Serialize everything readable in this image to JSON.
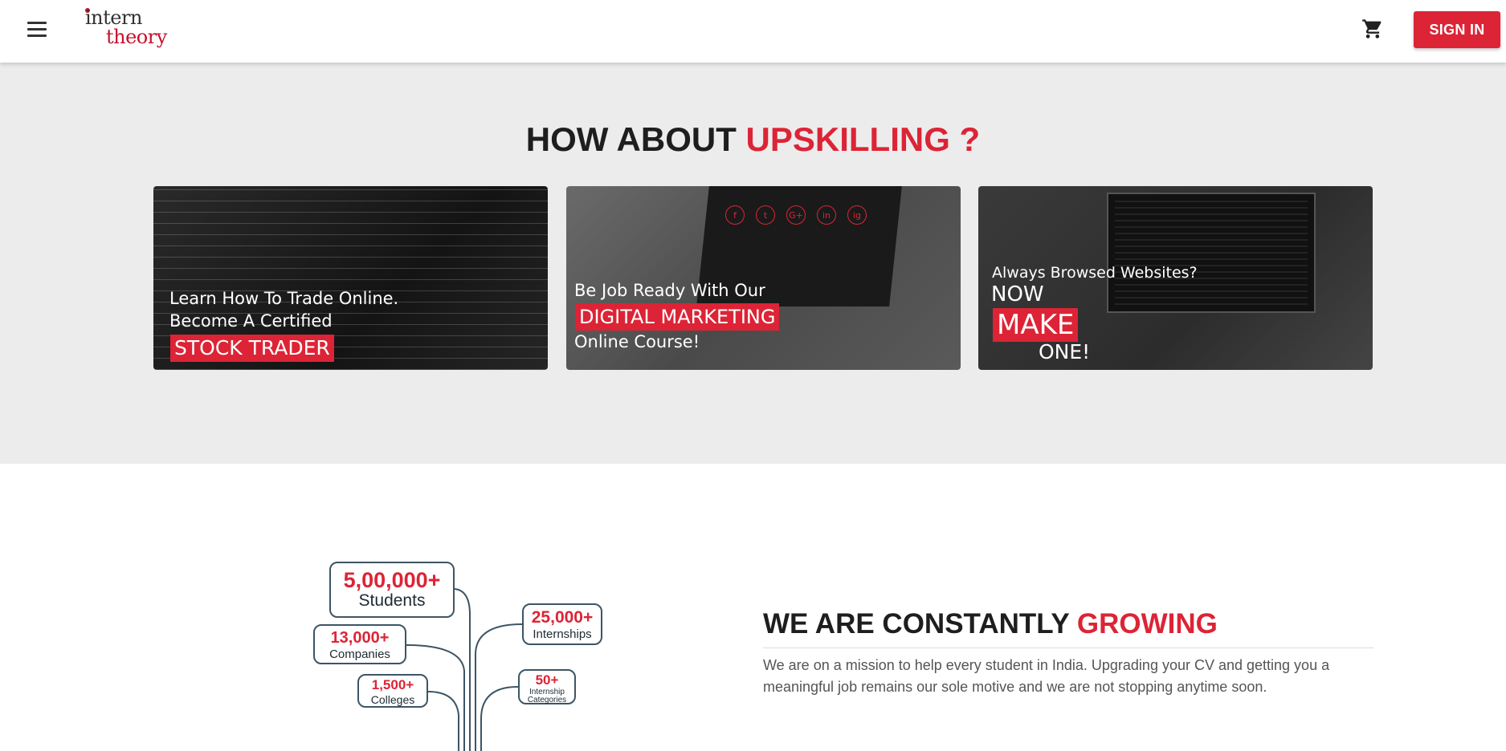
{
  "header": {
    "logo_line1": "intern",
    "logo_line2": "theory",
    "signin_label": "SIGN IN",
    "menu_icon": "hamburger-menu-icon",
    "cart_icon": "shopping-cart-icon"
  },
  "upskill": {
    "title_part1": "HOW ABOUT ",
    "title_part2": "UPSKILLING ?",
    "cards": [
      {
        "line1": "Learn How To Trade Online.",
        "line2": "Become A Certified",
        "highlight": "STOCK TRADER"
      },
      {
        "line1": "Be Job Ready With Our",
        "highlight": "DIGITAL MARKETING",
        "line3": "Online Course!",
        "social_icons": [
          "f",
          "t",
          "G+",
          "in",
          "ig"
        ]
      },
      {
        "line1": "Always Browsed Websites?",
        "line2": "NOW",
        "highlight": "MAKE",
        "line4": "ONE!"
      }
    ]
  },
  "growth": {
    "title_part1": "WE ARE CONSTANTLY ",
    "title_part2": "GROWING",
    "description": "We are on a mission to help every student in India. Upgrading your CV and getting you a meaningful job remains our sole motive and we are not stopping anytime soon.",
    "stats": [
      {
        "value": "5,00,000+",
        "label": "Students"
      },
      {
        "value": "13,000+",
        "label": "Companies"
      },
      {
        "value": "1,500+",
        "label": "Colleges"
      },
      {
        "value": "25,000+",
        "label": "Internships"
      },
      {
        "value": "50+",
        "label": "Internship Categories"
      }
    ]
  },
  "colors": {
    "brand_red": "#dc2436",
    "section_bg": "#ececec",
    "tag_border": "#3d5565"
  }
}
